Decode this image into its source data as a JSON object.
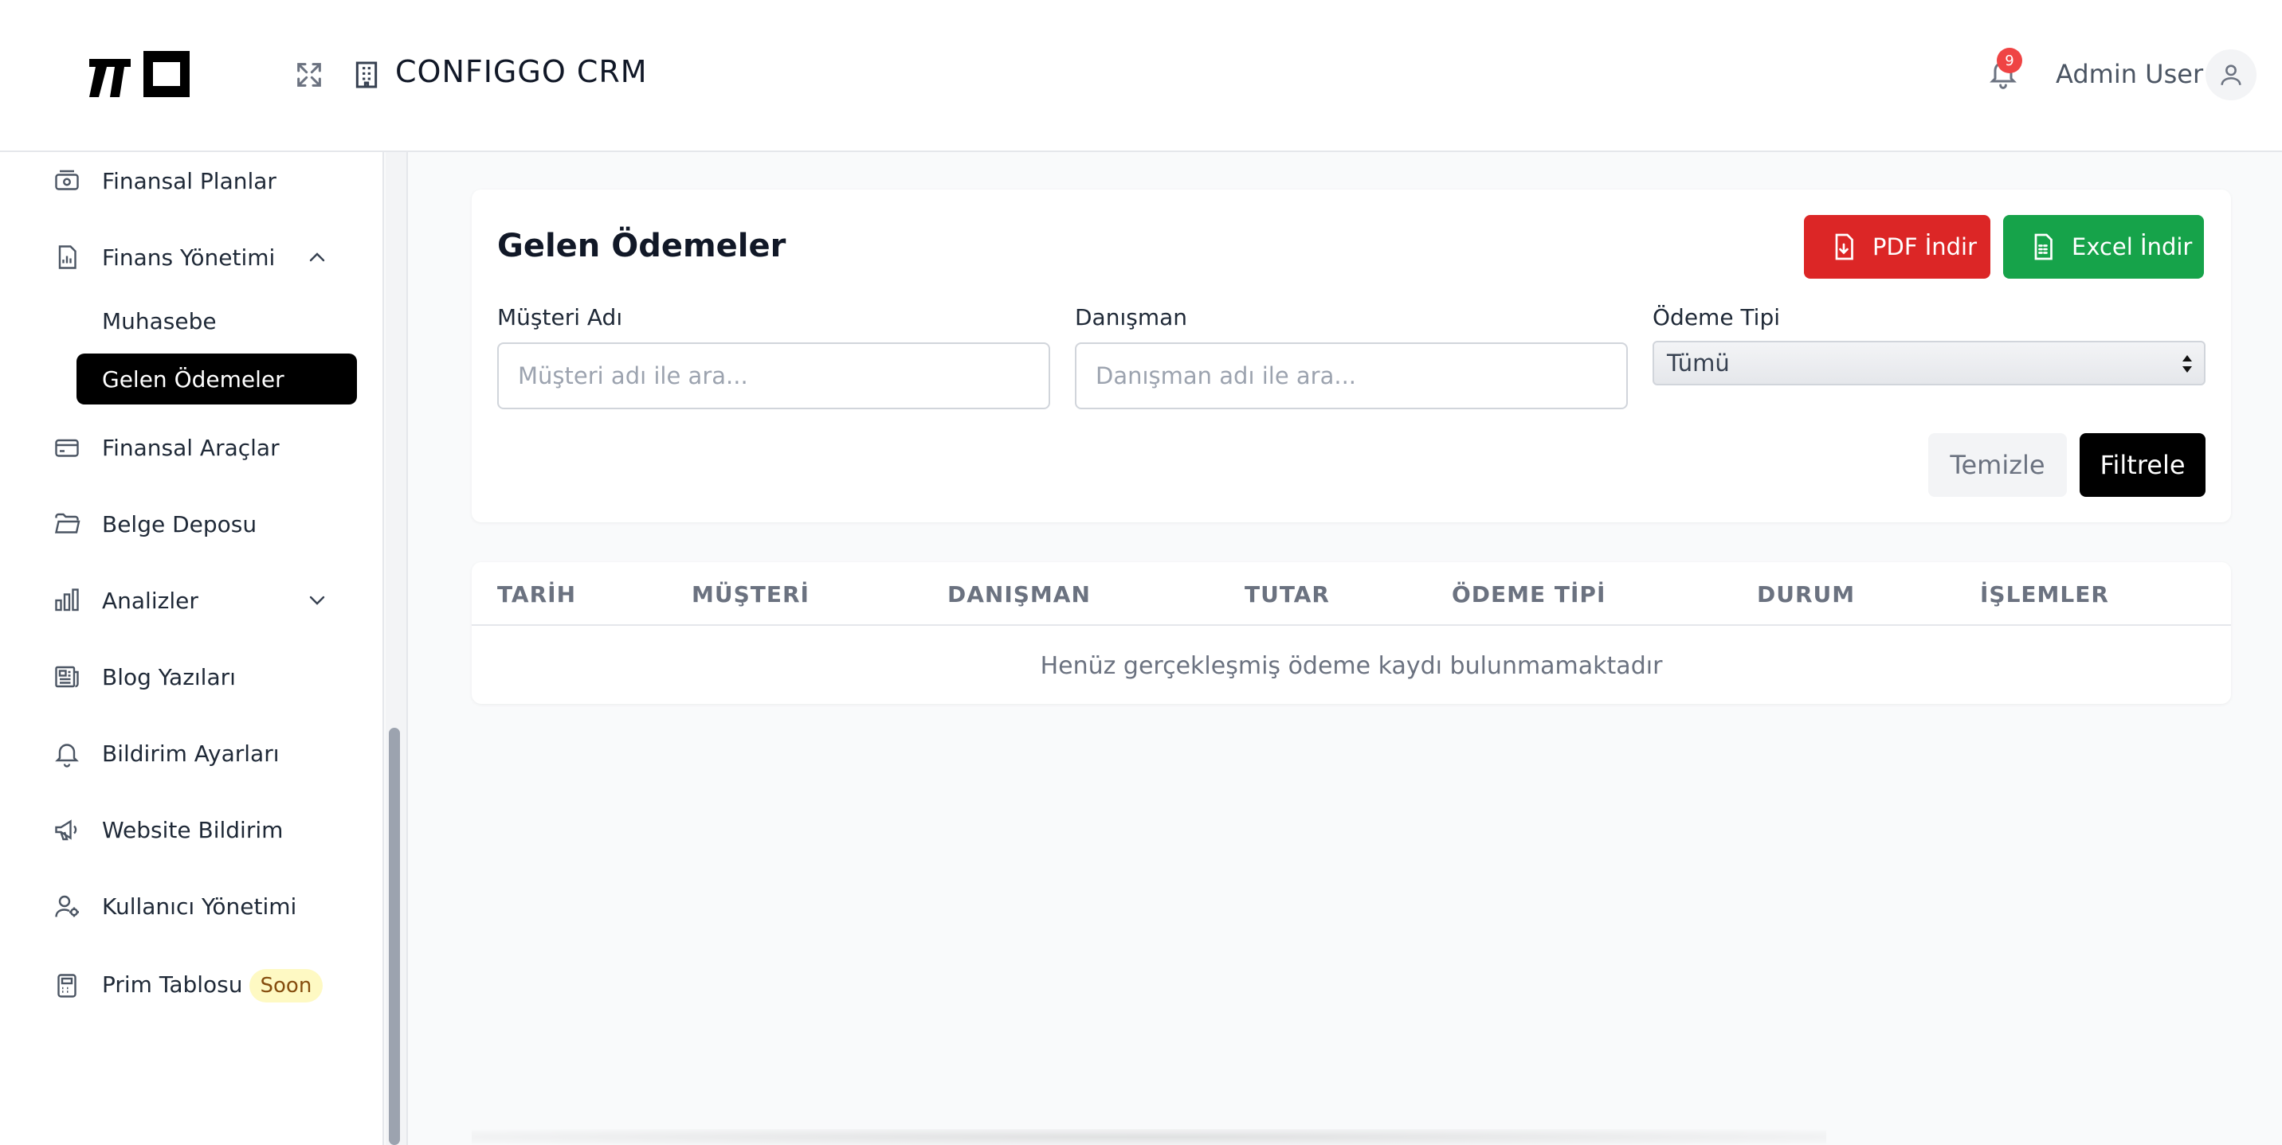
{
  "header": {
    "logo_text": "ΠΟ",
    "app_title": "CONFIGGO  CRM",
    "notification_count": "9",
    "user_name": "Admin User",
    "icons": [
      "expand-icon",
      "building-icon",
      "bell-icon",
      "user-icon"
    ]
  },
  "sidebar": {
    "items": [
      {
        "label": "Finansal Planlar",
        "icon": "cash-icon"
      },
      {
        "label": "Finans Yönetimi",
        "icon": "bar-chart-icon",
        "expanded": true
      },
      {
        "label": "Finansal Araçlar",
        "icon": "credit-card-icon"
      },
      {
        "label": "Belge Deposu",
        "icon": "folder-icon"
      },
      {
        "label": "Analizler",
        "icon": "analytics-icon",
        "expanded": false
      },
      {
        "label": "Blog Yazıları",
        "icon": "newspaper-icon"
      },
      {
        "label": "Bildirim Ayarları",
        "icon": "bell-icon"
      },
      {
        "label": "Website Bildirim",
        "icon": "megaphone-icon"
      },
      {
        "label": "Kullanıcı Yönetimi",
        "icon": "user-cog-icon"
      },
      {
        "label": "Prim Tablosu",
        "icon": "calculator-icon",
        "badge": "Soon"
      }
    ],
    "sub_items": [
      {
        "label": "Muhasebe",
        "active": false
      },
      {
        "label": "Gelen Ödemeler",
        "active": true
      }
    ]
  },
  "filters": {
    "title": "Gelen Ödemeler",
    "pdf_button": "PDF İndir",
    "excel_button": "Excel İndir",
    "customer_label": "Müşteri Adı",
    "customer_placeholder": "Müşteri adı ile ara...",
    "consultant_label": "Danışman",
    "consultant_placeholder": "Danışman adı ile ara...",
    "payment_type_label": "Ödeme Tipi",
    "payment_type_value": "Tümü",
    "clear_button": "Temizle",
    "filter_button": "Filtrele"
  },
  "table": {
    "columns": [
      "TARİH",
      "MÜŞTERİ",
      "DANIŞMAN",
      "TUTAR",
      "ÖDEME TİPİ",
      "DURUM",
      "İŞLEMLER"
    ],
    "empty_message": "Henüz gerçekleşmiş ödeme kaydı bulunmamaktadır"
  },
  "colors": {
    "pdf_button": "#dc2626",
    "excel_button": "#16a34a",
    "active_nav": "#000000",
    "badge": "#ef4444",
    "soon_badge": "#fef9c3"
  }
}
